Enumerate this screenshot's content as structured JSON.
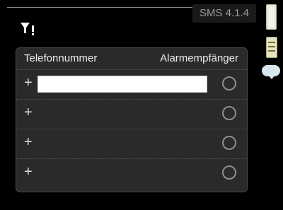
{
  "menu_id": "SMS 4.1.4",
  "table": {
    "col_phone": "Telefonnummer",
    "col_alarm": "Alarmempfänger",
    "rows": [
      {
        "add_symbol": "+",
        "phone_value": "",
        "alarm_selected": false
      },
      {
        "add_symbol": "+",
        "phone_value": "",
        "alarm_selected": false
      },
      {
        "add_symbol": "+",
        "phone_value": "",
        "alarm_selected": false
      },
      {
        "add_symbol": "+",
        "phone_value": "",
        "alarm_selected": false
      }
    ]
  },
  "icons": {
    "filter": "filter-alert-icon",
    "scroll": "scroll-indicator-icon",
    "tool": "tool-icon",
    "chat": "chat-bubble-icon"
  }
}
